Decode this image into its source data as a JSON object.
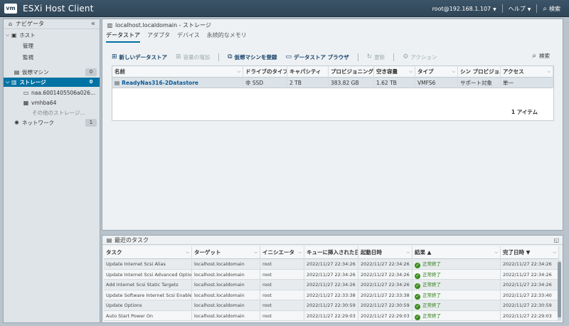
{
  "header": {
    "logo": "vm",
    "app_title": "ESXi Host Client",
    "user": "root@192.168.1.107",
    "help": "ヘルプ",
    "search": "検索"
  },
  "navigator": {
    "title": "ナビゲータ",
    "items": [
      {
        "label": "ホスト",
        "icon": "host-icon"
      },
      {
        "label": "管理"
      },
      {
        "label": "監視"
      },
      {
        "label": "仮想マシン",
        "badge": "0",
        "icon": "vm-icon"
      },
      {
        "label": "ストレージ",
        "badge": "0",
        "icon": "storage-icon"
      },
      {
        "label": "naa.6001405506a026...",
        "icon": "disk-icon"
      },
      {
        "label": "vmhba64",
        "icon": "hba-icon"
      },
      {
        "label": "その他のストレージ..."
      },
      {
        "label": "ネットワーク",
        "badge": "1",
        "icon": "network-icon"
      }
    ]
  },
  "main": {
    "title": "localhost.localdomain - ストレージ",
    "tabs": [
      "データストア",
      "アダプタ",
      "デバイス",
      "永続的なメモリ"
    ],
    "toolbar": {
      "new_datastore": "新しいデータストア",
      "increase_capacity": "容量の増加",
      "register_vm": "仮想マシンを登録",
      "browser": "データストア ブラウザ",
      "refresh": "更新",
      "actions": "アクション",
      "search_placeholder": "検索"
    },
    "columns": [
      "名前",
      "ドライブのタイプ",
      "キャパシティ",
      "プロビジョニング",
      "空き容量",
      "タイプ",
      "シン プロビジョニング",
      "アクセス"
    ],
    "rows": [
      {
        "name": "ReadyNas316-2Datastore",
        "drive": "非 SSD",
        "capacity": "2 TB",
        "provisioned": "383.82 GB",
        "free": "1.62 TB",
        "type": "VMFS6",
        "thin": "サポート対象",
        "access": "単一"
      }
    ],
    "item_count": "1 アイテム"
  },
  "tasks": {
    "title": "最近のタスク",
    "columns": [
      "タスク",
      "ターゲット",
      "イニシエータ",
      "キューに挿入された日時",
      "起動日時",
      "結果 ▲",
      "完了日時 ▼"
    ],
    "rows": [
      {
        "task": "Update Internet Scsi Alias",
        "target": "localhost.localdomain",
        "initiator": "root",
        "queued": "2022/11/27 22:34:26",
        "started": "2022/11/27 22:34:26",
        "result": "正常終了",
        "completed": "2022/11/27 22:34:26"
      },
      {
        "task": "Update Internet Scsi Advanced Options",
        "target": "localhost.localdomain",
        "initiator": "root",
        "queued": "2022/11/27 22:34:26",
        "started": "2022/11/27 22:34:26",
        "result": "正常終了",
        "completed": "2022/11/27 22:34:26"
      },
      {
        "task": "Add Internet Scsi Static Targets",
        "target": "localhost.localdomain",
        "initiator": "root",
        "queued": "2022/11/27 22:34:26",
        "started": "2022/11/27 22:34:26",
        "result": "正常終了",
        "completed": "2022/11/27 22:34:26"
      },
      {
        "task": "Update Software Internet Scsi Enabled",
        "target": "localhost.localdomain",
        "initiator": "root",
        "queued": "2022/11/27 22:33:38",
        "started": "2022/11/27 22:33:38",
        "result": "正常終了",
        "completed": "2022/11/27 22:33:40"
      },
      {
        "task": "Update Options",
        "target": "localhost.localdomain",
        "initiator": "root",
        "queued": "2022/11/27 22:30:59",
        "started": "2022/11/27 22:30:59",
        "result": "正常終了",
        "completed": "2022/11/27 22:30:59"
      },
      {
        "task": "Auto Start Power On",
        "target": "localhost.localdomain",
        "initiator": "root",
        "queued": "2022/11/27 22:29:03",
        "started": "2022/11/27 22:29:03",
        "result": "正常終了",
        "completed": "2022/11/27 22:29:03"
      }
    ]
  }
}
